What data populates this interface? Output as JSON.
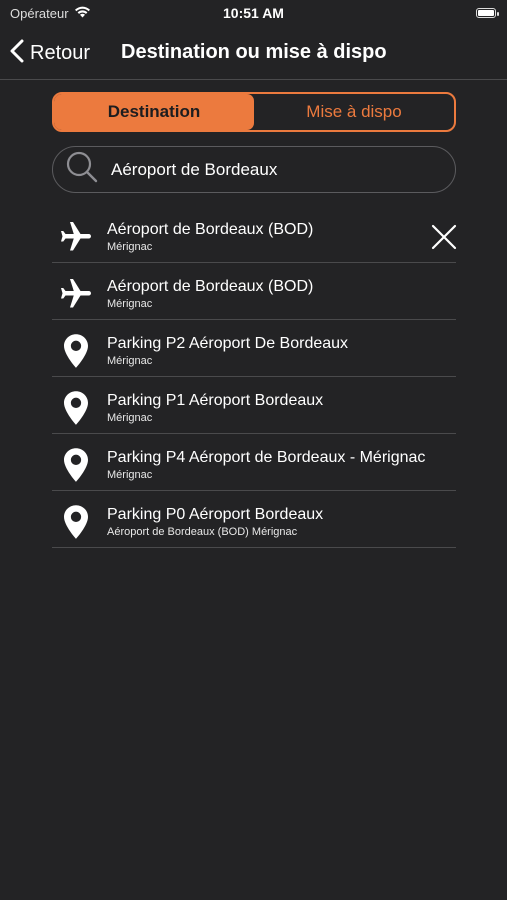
{
  "status_bar": {
    "carrier": "Opérateur",
    "time": "10:51 AM",
    "icons": [
      "wifi-icon",
      "battery-icon"
    ]
  },
  "nav": {
    "back_label": "Retour",
    "title": "Destination ou mise à dispo"
  },
  "segments": {
    "destination": "Destination",
    "mise_a_dispo": "Mise à dispo",
    "selected": "Destination"
  },
  "search": {
    "value": "Aéroport de Bordeaux"
  },
  "results": [
    {
      "icon": "airplane-icon",
      "title": "Aéroport de Bordeaux (BOD)",
      "subtitle": "Mérignac"
    },
    {
      "icon": "airplane-icon",
      "title": "Aéroport de Bordeaux (BOD)",
      "subtitle": "Mérignac"
    },
    {
      "icon": "location-pin-icon",
      "title": "Parking P2 Aéroport De Bordeaux",
      "subtitle": "Mérignac"
    },
    {
      "icon": "location-pin-icon",
      "title": "Parking P1 Aéroport Bordeaux",
      "subtitle": "Mérignac"
    },
    {
      "icon": "location-pin-icon",
      "title": "Parking P4 Aéroport de Bordeaux - Mérignac",
      "subtitle": "Mérignac"
    },
    {
      "icon": "location-pin-icon",
      "title": "Parking P0 Aéroport Bordeaux",
      "subtitle": "Aéroport de Bordeaux (BOD) Mérignac"
    }
  ],
  "colors": {
    "accent": "#ec7a3e",
    "background": "#232325"
  }
}
